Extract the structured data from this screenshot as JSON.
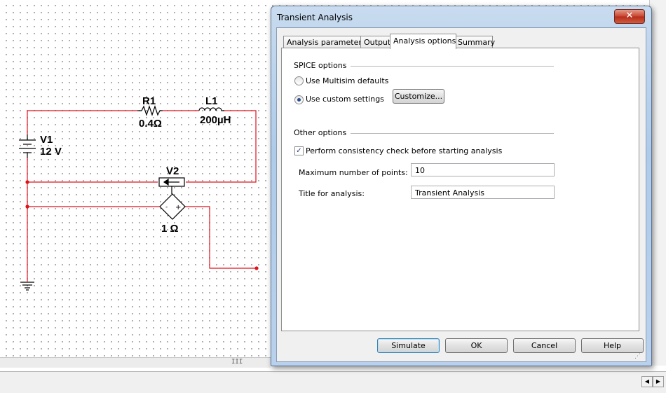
{
  "schematic": {
    "resistor": {
      "ref": "R1",
      "value": "0.4Ω"
    },
    "inductor": {
      "ref": "L1",
      "value": "200µH"
    },
    "source": {
      "ref": "V1",
      "value": "12 V"
    },
    "controlled_source": {
      "ref": "V2",
      "value": "1 Ω",
      "minus": "-",
      "plus": "+"
    },
    "scroll_grip": "III"
  },
  "dialog": {
    "title": "Transient Analysis",
    "close_glyph": "✕",
    "tabs": [
      {
        "label": "Analysis parameters",
        "active": false
      },
      {
        "label": "Output",
        "active": false
      },
      {
        "label": "Analysis options",
        "active": true
      },
      {
        "label": "Summary",
        "active": false
      }
    ],
    "spice": {
      "heading": "SPICE options",
      "option_defaults": "Use Multisim defaults",
      "option_custom": "Use custom settings",
      "selected": "custom",
      "customize_label": "Customize..."
    },
    "other": {
      "heading": "Other options",
      "consistency_label": "Perform consistency check before starting analysis",
      "consistency_checked": true,
      "max_points_label": "Maximum number of points:",
      "max_points_value": "10",
      "title_label": "Title for analysis:",
      "title_value": "Transient Analysis"
    },
    "buttons": {
      "simulate": "Simulate",
      "ok": "OK",
      "cancel": "Cancel",
      "help": "Help"
    }
  },
  "colors": {
    "wire": "#e0121a",
    "selection_blue": "#3c7fb1",
    "close_red": "#c8442f"
  },
  "icons": [
    "close-icon",
    "resize-grip-icon",
    "scroll-left-icon",
    "scroll-right-icon",
    "check-icon"
  ]
}
